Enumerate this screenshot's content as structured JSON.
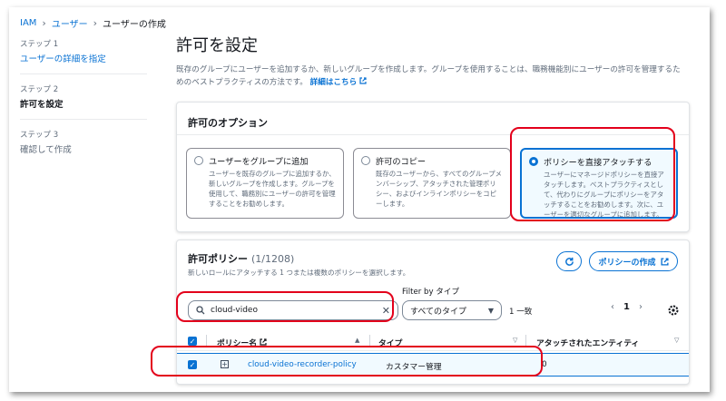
{
  "breadcrumb": {
    "root": "IAM",
    "users": "ユーザー",
    "current": "ユーザーの作成"
  },
  "steps": [
    {
      "num": "ステップ 1",
      "title": "ユーザーの詳細を指定"
    },
    {
      "num": "ステップ 2",
      "title": "許可を設定"
    },
    {
      "num": "ステップ 3",
      "title": "確認して作成"
    }
  ],
  "page": {
    "title": "許可を設定",
    "description": "既存のグループにユーザーを追加するか、新しいグループを作成します。グループを使用することは、職務機能別にユーザーの許可を管理するためのベストプラクティスの方法です。",
    "learn_more": "詳細はこちら"
  },
  "options": {
    "header": "許可のオプション",
    "tiles": [
      {
        "title": "ユーザーをグループに追加",
        "desc": "ユーザーを既存のグループに追加するか、新しいグループを作成します。グループを使用して、職務別にユーザーの許可を管理することをお勧めします。"
      },
      {
        "title": "許可のコピー",
        "desc": "既存のユーザーから、すべてのグループメンバーシップ、アタッチされた管理ポリシー、およびインラインポリシーをコピーします。"
      },
      {
        "title": "ポリシーを直接アタッチする",
        "desc": "ユーザーにマネージドポリシーを直接アタッチします。ベストプラクティスとして、代わりにグループにポリシーをアタッチすることをお勧めします。次に、ユーザーを適切なグループに追加します。"
      }
    ],
    "selected_index": 2
  },
  "policies": {
    "title": "許可ポリシー",
    "count": "(1/1208)",
    "subtitle": "新しいロールにアタッチする 1 つまたは複数のポリシーを選択します。",
    "create_button": "ポリシーの作成",
    "filter_label": "Filter by タイプ",
    "search_value": "cloud-video",
    "type_select": "すべてのタイプ",
    "match_text": "1 一致",
    "page_number": "1",
    "columns": [
      "ポリシー名",
      "タイプ",
      "アタッチされたエンティティ"
    ],
    "rows": [
      {
        "name": "cloud-video-recorder-policy",
        "type": "カスタマー管理",
        "entities": "0"
      }
    ]
  },
  "colors": {
    "accent": "#0972d3",
    "highlight": "#e3001b"
  }
}
